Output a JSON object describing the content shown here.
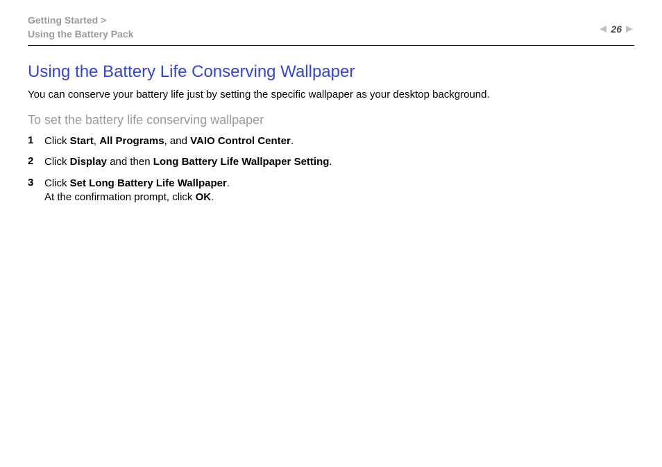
{
  "header": {
    "breadcrumb_line1": "Getting Started >",
    "breadcrumb_line2": "Using the Battery Pack",
    "page_number": "26"
  },
  "title": "Using the Battery Life Conserving Wallpaper",
  "intro": "You can conserve your battery life just by setting the specific wallpaper as your desktop background.",
  "subhead": "To set the battery life conserving wallpaper",
  "steps": [
    {
      "n": "1",
      "parts": [
        "Click ",
        "Start",
        ", ",
        "All Programs",
        ", and ",
        "VAIO Control Center",
        "."
      ],
      "bold": [
        1,
        3,
        5
      ]
    },
    {
      "n": "2",
      "parts": [
        "Click ",
        "Display",
        " and then ",
        "Long Battery Life Wallpaper Setting",
        "."
      ],
      "bold": [
        1,
        3
      ]
    },
    {
      "n": "3",
      "parts": [
        "Click ",
        "Set Long Battery Life Wallpaper",
        ".",
        "\n",
        "At the confirmation prompt, click ",
        "OK",
        "."
      ],
      "bold": [
        1,
        5
      ]
    }
  ]
}
